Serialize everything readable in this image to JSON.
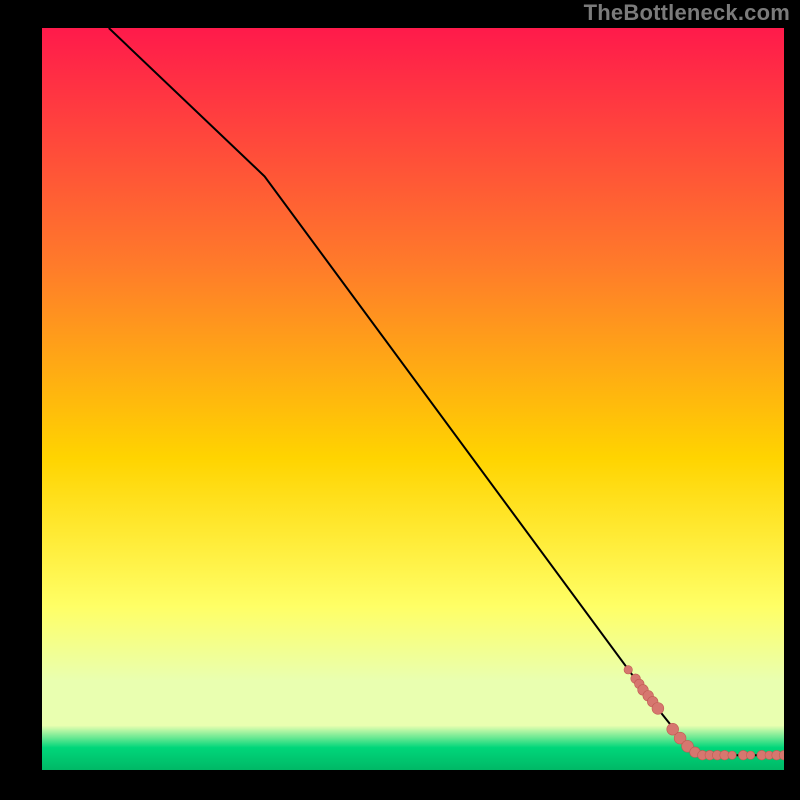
{
  "watermark": "TheBottleneck.com",
  "colors": {
    "frame_bg": "#000000",
    "gradient_top": "#ff1a4b",
    "gradient_mid1": "#ff7b2a",
    "gradient_mid2": "#ffd400",
    "gradient_yellow": "#ffff66",
    "gradient_pale": "#e9ffb0",
    "gradient_green": "#00d67a",
    "gradient_bottom": "#00b866",
    "line": "#000000",
    "marker_fill": "#d6776f",
    "marker_stroke": "#c05a52"
  },
  "chart_data": {
    "type": "line",
    "title": "",
    "xlabel": "",
    "ylabel": "",
    "xlim": [
      0,
      100
    ],
    "ylim": [
      0,
      100
    ],
    "series": [
      {
        "name": "curve",
        "x": [
          9,
          30,
          82,
          88,
          100
        ],
        "y": [
          100,
          80,
          9.5,
          2,
          2
        ]
      }
    ],
    "markers": {
      "name": "points",
      "x": [
        79,
        80,
        80.5,
        81,
        81.7,
        82.3,
        83,
        85,
        86,
        87,
        88,
        89,
        90,
        91,
        92,
        93,
        94.5,
        95.5,
        97,
        98,
        99,
        100
      ],
      "y": [
        13.5,
        12.3,
        11.6,
        10.8,
        10,
        9.2,
        8.3,
        5.5,
        4.3,
        3.2,
        2.4,
        2,
        2,
        2,
        2,
        2,
        2,
        2,
        2,
        2,
        2,
        2
      ],
      "r": [
        3,
        3.4,
        3.4,
        3.8,
        3.8,
        3.8,
        4.2,
        4.2,
        4.2,
        4.2,
        3.8,
        3.4,
        3.4,
        3.4,
        3.4,
        3,
        3.4,
        3,
        3.4,
        3,
        3.4,
        3.4
      ]
    }
  }
}
